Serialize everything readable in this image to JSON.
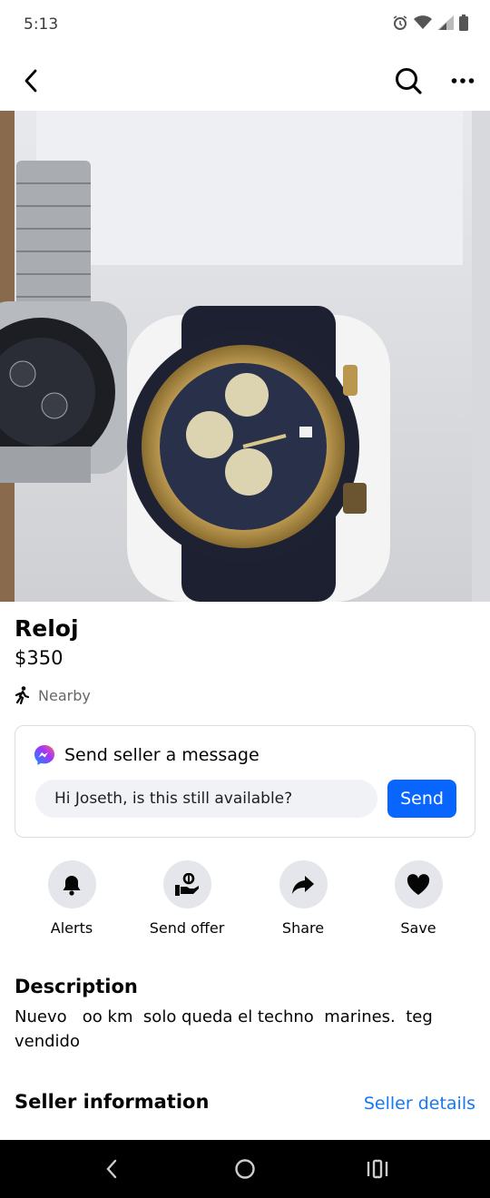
{
  "status_bar": {
    "time": "5:13",
    "icons": [
      "alarm-icon",
      "wifi-icon",
      "signal-icon",
      "battery-icon"
    ]
  },
  "top_bar": {
    "icons": [
      "back-icon",
      "search-icon",
      "more-icon"
    ]
  },
  "listing": {
    "title": "Reloj",
    "price": "$350",
    "location": "Nearby"
  },
  "message": {
    "heading": "Send seller a message",
    "input_value": "Hi Joseth, is this still available?",
    "send_label": "Send"
  },
  "actions": [
    {
      "label": "Alerts",
      "icon": "bell-icon"
    },
    {
      "label": "Send offer",
      "icon": "offer-icon"
    },
    {
      "label": "Share",
      "icon": "share-icon"
    },
    {
      "label": "Save",
      "icon": "heart-icon"
    }
  ],
  "description": {
    "heading": "Description",
    "text": "Nuevo   oo km  solo queda el techno  marines.  teg vendido"
  },
  "seller": {
    "heading": "Seller information",
    "details_link": "Seller details"
  },
  "colors": {
    "accent": "#0866ff",
    "link": "#1877f2",
    "muted": "#65676b",
    "chip_bg": "#e4e6eb"
  }
}
